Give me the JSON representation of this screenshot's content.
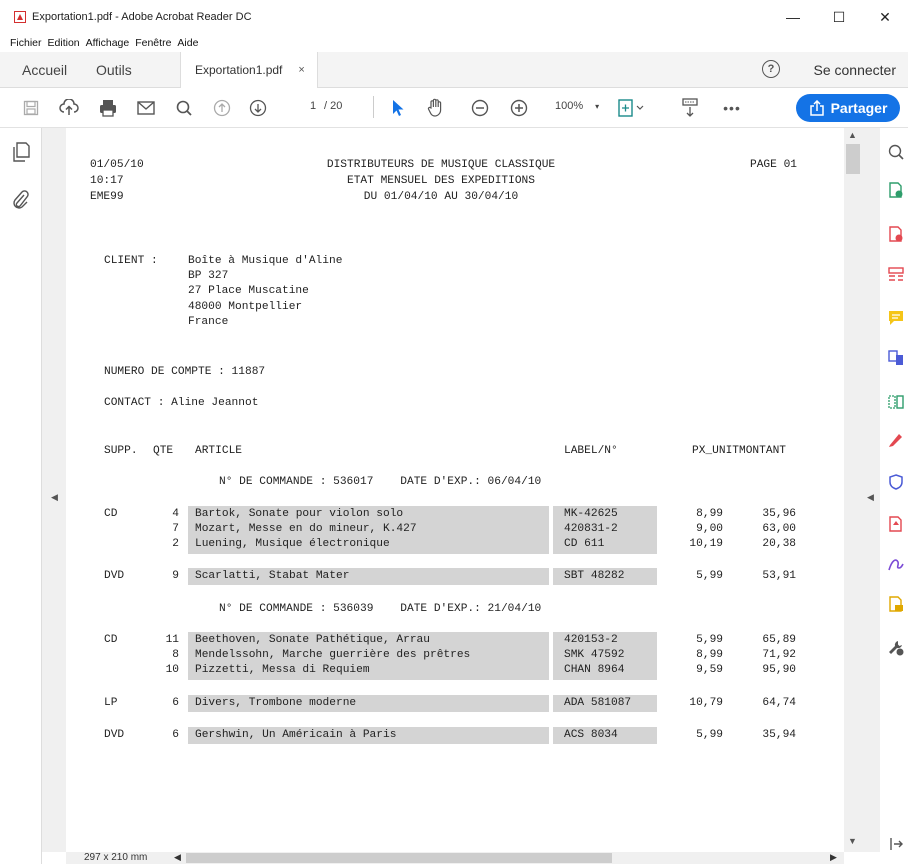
{
  "window": {
    "title": "Exportation1.pdf - Adobe Acrobat Reader DC",
    "min": "—",
    "max": "☐",
    "close": "✕"
  },
  "menu": [
    "Fichier",
    "Edition",
    "Affichage",
    "Fenêtre",
    "Aide"
  ],
  "tabs": {
    "home": "Accueil",
    "tools": "Outils",
    "doc": "Exportation1.pdf",
    "close": "×"
  },
  "header": {
    "help": "?",
    "login": "Se connecter"
  },
  "toolbar": {
    "page_current": "1",
    "page_total": "/ 20",
    "zoom": "100%",
    "share": "Partager"
  },
  "status": {
    "dims": "297 x 210 mm"
  },
  "report": {
    "date": "01/05/10",
    "time": "10:17",
    "code": "EME99",
    "title1": "DISTRIBUTEURS DE MUSIQUE CLASSIQUE",
    "title2": "ETAT MENSUEL DES EXPEDITIONS",
    "title3": "DU 01/04/10 AU 30/04/10",
    "page": "PAGE 01",
    "client_label": "CLIENT :",
    "client_lines": [
      "Boîte à Musique d'Aline",
      "BP 327",
      "27 Place Muscatine",
      "48000 Montpellier",
      "France"
    ],
    "account": "NUMERO DE COMPTE : 11887",
    "contact": "CONTACT : Aline Jeannot",
    "headers": {
      "supp": "SUPP.",
      "qte": "QTE",
      "article": "ARTICLE",
      "label": "LABEL/N°",
      "px": "PX_UNIT",
      "montant": "MONTANT"
    },
    "orders": [
      {
        "heading": "N° DE COMMANDE : 536017    DATE D'EXP.: 06/04/10",
        "groups": [
          {
            "supp": "CD",
            "items": [
              {
                "qte": "4",
                "article": "Bartok, Sonate pour violon solo",
                "label": "MK-42625",
                "px": "8,99",
                "montant": "35,96"
              },
              {
                "qte": "7",
                "article": "Mozart, Messe en do mineur, K.427",
                "label": "420831-2",
                "px": "9,00",
                "montant": "63,00"
              },
              {
                "qte": "2",
                "article": "Luening, Musique électronique",
                "label": "CD 611",
                "px": "10,19",
                "montant": "20,38"
              }
            ]
          },
          {
            "supp": "DVD",
            "items": [
              {
                "qte": "9",
                "article": "Scarlatti, Stabat Mater",
                "label": "SBT 48282",
                "px": "5,99",
                "montant": "53,91"
              }
            ]
          }
        ]
      },
      {
        "heading": "N° DE COMMANDE : 536039    DATE D'EXP.: 21/04/10",
        "groups": [
          {
            "supp": "CD",
            "items": [
              {
                "qte": "11",
                "article": "Beethoven, Sonate Pathétique, Arrau",
                "label": "420153-2",
                "px": "5,99",
                "montant": "65,89"
              },
              {
                "qte": "8",
                "article": "Mendelssohn, Marche guerrière des prêtres",
                "label": "SMK 47592",
                "px": "8,99",
                "montant": "71,92"
              },
              {
                "qte": "10",
                "article": "Pizzetti, Messa di Requiem",
                "label": "CHAN 8964",
                "px": "9,59",
                "montant": "95,90"
              }
            ]
          },
          {
            "supp": "LP",
            "items": [
              {
                "qte": "6",
                "article": "Divers, Trombone moderne",
                "label": "ADA 581087",
                "px": "10,79",
                "montant": "64,74"
              }
            ]
          },
          {
            "supp": "DVD",
            "items": [
              {
                "qte": "6",
                "article": "Gershwin, Un Américain à Paris",
                "label": "ACS 8034",
                "px": "5,99",
                "montant": "35,94"
              }
            ]
          }
        ]
      }
    ]
  }
}
